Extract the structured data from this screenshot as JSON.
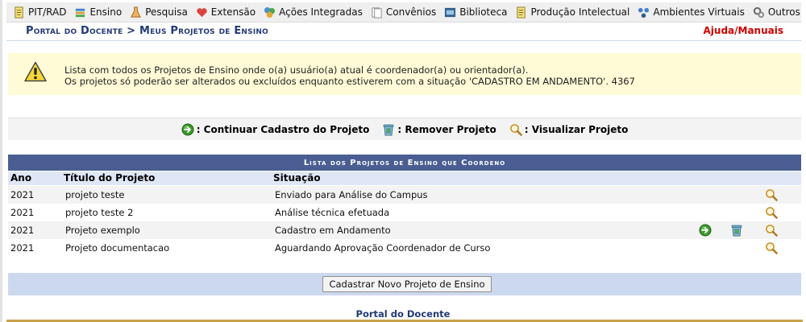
{
  "menu": {
    "items": [
      {
        "label": "PIT/RAD",
        "icon": "notepad-icon"
      },
      {
        "label": "Ensino",
        "icon": "books-icon"
      },
      {
        "label": "Pesquisa",
        "icon": "flask-icon"
      },
      {
        "label": "Extensão",
        "icon": "heart-hands-icon"
      },
      {
        "label": "Ações Integradas",
        "icon": "puzzle-icon"
      },
      {
        "label": "Convênios",
        "icon": "documents-icon"
      },
      {
        "label": "Biblioteca",
        "icon": "library-icon"
      },
      {
        "label": "Produção Intelectual",
        "icon": "notepad-icon"
      },
      {
        "label": "Ambientes Virtuais",
        "icon": "network-icon"
      },
      {
        "label": "Outros",
        "icon": "gears-icon"
      }
    ]
  },
  "header": {
    "title": "Portal do Docente > Meus Projetos de Ensino",
    "help": "Ajuda/Manuais"
  },
  "warning": {
    "line1": "Lista com todos os Projetos de Ensino onde o(a) usuário(a) atual é coordenador(a) ou orientador(a).",
    "line2": "Os projetos só poderão ser alterados ou excluídos enquanto estiverem com a situação 'CADASTRO EM ANDAMENTO'. 4367"
  },
  "legend": {
    "continue": ": Continuar Cadastro do Projeto",
    "remove": ": Remover Projeto",
    "view": ": Visualizar Projeto"
  },
  "table": {
    "caption": "Lista dos Projetos de Ensino que Coordeno",
    "headers": {
      "year": "Ano",
      "title": "Título do Projeto",
      "status": "Situação"
    },
    "rows": [
      {
        "year": "2021",
        "title": "projeto teste",
        "status": "Enviado para Análise do Campus",
        "actions": [
          "view"
        ]
      },
      {
        "year": "2021",
        "title": "projeto teste 2",
        "status": "Análise técnica efetuada",
        "actions": [
          "view"
        ]
      },
      {
        "year": "2021",
        "title": "Projeto exemplo",
        "status": "Cadastro em Andamento",
        "actions": [
          "continue",
          "remove",
          "view"
        ]
      },
      {
        "year": "2021",
        "title": "Projeto documentacao",
        "status": "Aguardando Aprovação Coordenador de Curso",
        "actions": [
          "view"
        ]
      }
    ]
  },
  "footer": {
    "new_button": "Cadastrar Novo Projeto de Ensino",
    "portal_link": "Portal do Docente"
  },
  "colors": {
    "caption_bg": "#4a5e93",
    "header_text": "#233a78",
    "help_text": "#cc0000",
    "warning_bg": "#fffbd6",
    "table_header_bg": "#dfe7f7",
    "bottom_bar": "#caa24a"
  }
}
